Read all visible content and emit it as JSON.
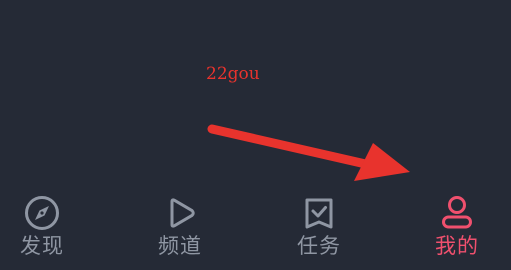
{
  "watermark": {
    "text": "22gou"
  },
  "colors": {
    "background": "#252a36",
    "inactive": "#8f96a3",
    "active": "#f0506e",
    "annotation_red": "#e8332d"
  },
  "tabbar": {
    "tabs": [
      {
        "label": "发现",
        "icon": "compass-icon",
        "active": false
      },
      {
        "label": "频道",
        "icon": "play-icon",
        "active": false
      },
      {
        "label": "任务",
        "icon": "task-bookmark-icon",
        "active": false
      },
      {
        "label": "我的",
        "icon": "user-icon",
        "active": true
      }
    ]
  }
}
